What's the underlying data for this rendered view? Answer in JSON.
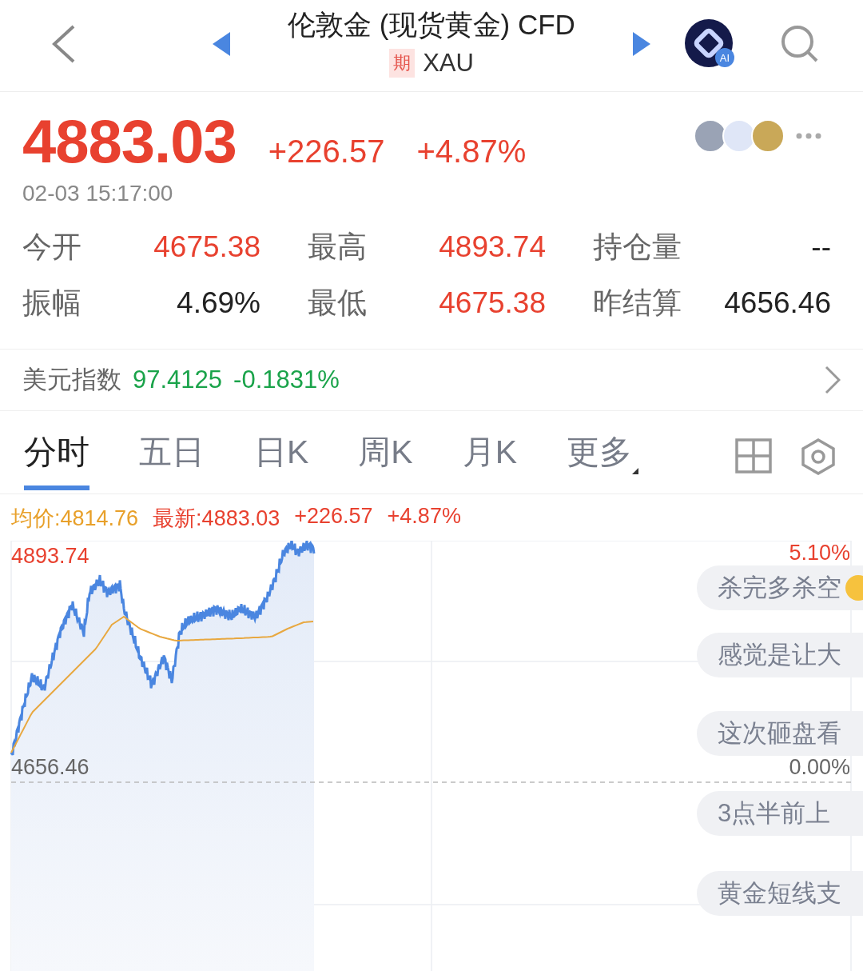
{
  "header": {
    "title": "伦敦金 (现货黄金) CFD",
    "badge": "期",
    "symbol": "XAU",
    "ai_badge": "AI"
  },
  "quote": {
    "price": "4883.03",
    "change": "+226.57",
    "change_pct": "+4.87%",
    "time": "02-03 15:17:00"
  },
  "stats": [
    {
      "label": "今开",
      "value": "4675.38",
      "color": "#e8412f"
    },
    {
      "label": "最高",
      "value": "4893.74",
      "color": "#e8412f"
    },
    {
      "label": "持仓量",
      "value": "--",
      "color": "#222222"
    },
    {
      "label": "振幅",
      "value": "4.69%",
      "color": "#222222"
    },
    {
      "label": "最低",
      "value": "4675.38",
      "color": "#e8412f"
    },
    {
      "label": "昨结算",
      "value": "4656.46",
      "color": "#222222"
    }
  ],
  "dollar_index": {
    "label": "美元指数",
    "value": "97.4125",
    "change": "-0.1831%"
  },
  "tabs": [
    {
      "label": "分时",
      "selected": true,
      "kind": "tab"
    },
    {
      "label": "五日",
      "selected": false,
      "kind": "tab"
    },
    {
      "label": "日K",
      "selected": false,
      "kind": "tab"
    },
    {
      "label": "周K",
      "selected": false,
      "kind": "tab"
    },
    {
      "label": "月K",
      "selected": false,
      "kind": "tab"
    },
    {
      "label": "更多",
      "selected": false,
      "kind": "menu"
    }
  ],
  "legend": {
    "avg": "均价:4814.76",
    "latest": "最新:4883.03",
    "change": "+226.57",
    "change_pct": "+4.87%"
  },
  "chart": {
    "high": "4893.74",
    "base": "4656.46",
    "high_pct": "5.10%",
    "base_pct": "0.00%"
  },
  "comments": [
    {
      "text": "杀完多杀空",
      "emoji": true
    },
    {
      "text": "感觉是让大",
      "emoji": false
    },
    {
      "text": "这次砸盘看",
      "emoji": false
    },
    {
      "text": "3点半前上",
      "emoji": false
    },
    {
      "text": "黄金短线支",
      "emoji": false
    }
  ]
}
